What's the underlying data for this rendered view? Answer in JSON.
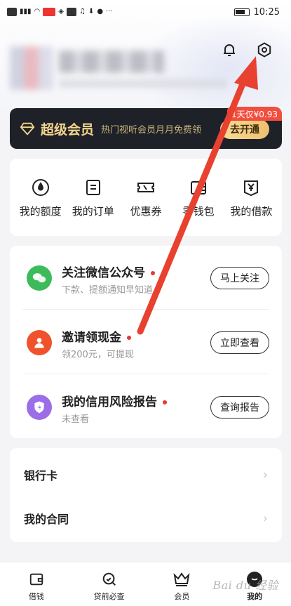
{
  "status_bar": {
    "time": "10:25"
  },
  "vip": {
    "title": "超级会员",
    "desc": "热门视听会员月月免费领",
    "button": "去开通",
    "tag": "1天仅¥0.93",
    "colors": {
      "background": "#1e2228",
      "gold": "#f5d48c",
      "tag": "#f24e3e"
    }
  },
  "quick_actions": [
    {
      "label": "我的额度",
      "icon": "quota-drop-icon"
    },
    {
      "label": "我的订单",
      "icon": "order-doc-icon"
    },
    {
      "label": "优惠券",
      "icon": "coupon-icon"
    },
    {
      "label": "零钱包",
      "icon": "wallet-icon"
    },
    {
      "label": "我的借款",
      "icon": "loan-yen-icon"
    }
  ],
  "tasks": [
    {
      "title": "关注微信公众号",
      "subtitle": "下款、提额通知早知道",
      "button": "马上关注",
      "icon": "wechat-icon",
      "icon_color": "#3dbb5a"
    },
    {
      "title": "邀请领现金",
      "subtitle": "领200元，可提现",
      "button": "立即查看",
      "icon": "invite-user-icon",
      "icon_color": "#f0522c"
    },
    {
      "title": "我的信用风险报告",
      "subtitle": "未查看",
      "button": "查询报告",
      "icon": "shield-report-icon",
      "icon_color": "#9b6ee8"
    }
  ],
  "links": [
    {
      "label": "银行卡"
    },
    {
      "label": "我的合同"
    }
  ],
  "bottom_nav": [
    {
      "label": "借钱",
      "icon": "wallet-nav-icon"
    },
    {
      "label": "贷前必查",
      "icon": "search-nav-icon"
    },
    {
      "label": "会员",
      "icon": "crown-nav-icon"
    },
    {
      "label": "我的",
      "icon": "profile-nav-icon",
      "active": true
    }
  ],
  "watermark": "Bai du 经验",
  "annotation": {
    "color": "#e8412f"
  }
}
